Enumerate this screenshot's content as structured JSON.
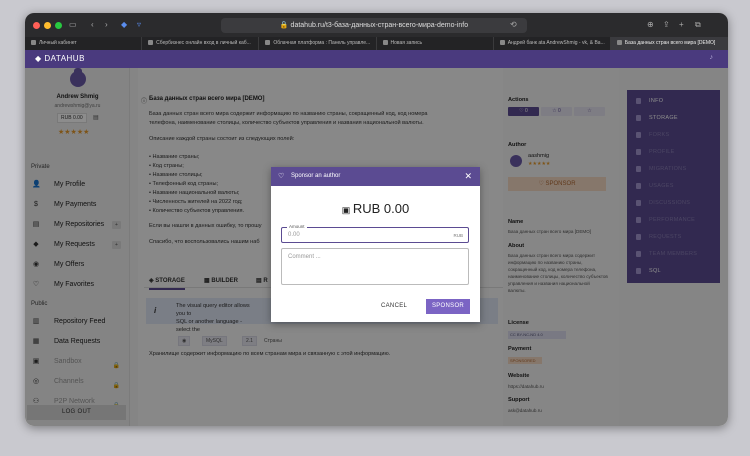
{
  "browser": {
    "url": "datahub.ru/t3-база-данных-стран-всего-мира-demo-info",
    "tabs": [
      {
        "label": "Личный кабинет"
      },
      {
        "label": "Сбербизнес онлайн вход в личный каб..."
      },
      {
        "label": "Облачная платформа : Панель управле..."
      },
      {
        "label": "Новая запись"
      },
      {
        "label": "Андрей банк ata AndrewShmig - vk, & Ва..."
      },
      {
        "label": "База данных стран всего мира [DEMO]"
      }
    ]
  },
  "app": {
    "brand": "DATAHUB"
  },
  "user": {
    "name": "Andrew Shmig",
    "email": "andrewshmig@ya.ru",
    "balance": "RUB 0.00",
    "stars": "★★★★★"
  },
  "sidebar": {
    "private_title": "Private",
    "public_title": "Public",
    "private_items": [
      {
        "label": "My Profile",
        "icon": "👤"
      },
      {
        "label": "My Payments",
        "icon": "$"
      },
      {
        "label": "My Repositories",
        "icon": "▤",
        "badge": "+"
      },
      {
        "label": "My Requests",
        "icon": "◆",
        "badge": "+"
      },
      {
        "label": "My Offers",
        "icon": "◉"
      },
      {
        "label": "My Favorites",
        "icon": "♡"
      }
    ],
    "public_items": [
      {
        "label": "Repository Feed",
        "icon": "▥"
      },
      {
        "label": "Data Requests",
        "icon": "▦"
      },
      {
        "label": "Sandbox",
        "icon": "▣",
        "lock": "🔒"
      },
      {
        "label": "Channels",
        "icon": "◎",
        "lock": "🔒"
      },
      {
        "label": "P2P Network",
        "icon": "⚇",
        "lock": "🔒"
      }
    ],
    "logout": "LOG OUT"
  },
  "main": {
    "title": "База данных стран всего мира [DEMO]",
    "desc1": "База данных стран всего мира содержит информацию по названию страны, сокращенный код, код номера",
    "desc2": "телефона, наименование столицы, количество субъектов управления и названия национальной валюты.",
    "desc3": "Описание каждой страны состоит из следующих полей:",
    "fields": [
      "Название страны;",
      "Код страны;",
      "Название столицы;",
      "Телефонный код страны;",
      "Название национальной валюты;",
      "Численность жителей на 2022 год;",
      "Количество субъектов управления."
    ],
    "error_text": "Если вы нашли в данных ошибку, то прошу",
    "thanks_text": "Спасибо, что воспользовались нашим наб",
    "tabs": [
      "STORAGE",
      "BUILDER",
      "R"
    ],
    "info1": "The visual query editor allows you to",
    "info2": "SQL or another language - select the",
    "chips": [
      "◉",
      "MySQL",
      "2.1",
      "Страны"
    ],
    "storage_desc": "Хранилище содержит информацию по всем странам мира и связанную с этой информацию."
  },
  "right": {
    "actions_label": "Actions",
    "actions": [
      "♡ 0",
      "☆ 0",
      "☆"
    ],
    "author_label": "Author",
    "author_name": "aashmig",
    "author_stars": "★★★★★",
    "sponsor": "♡ SPONSOR",
    "name_label": "Name",
    "name_value": "База данных стран всего мира [DEMO]",
    "about_label": "About",
    "about_value": "База данных стран всего мира содержит информацию по названию страны, сокращенный код, код номера телефона, наименование столицы, количество субъектов управления и названия национальной валюты.",
    "license_label": "License",
    "license_value": "CC BY-NC-ND 4.0",
    "payment_label": "Payment",
    "payment_value": "SPONSORED",
    "website_label": "Website",
    "website_value": "https://datahub.ru",
    "support_label": "Support",
    "support_value": "ask@datahub.ru"
  },
  "rightnav": [
    {
      "label": "INFO",
      "state": "active"
    },
    {
      "label": "STORAGE",
      "state": "active"
    },
    {
      "label": "FORKS",
      "state": "dim"
    },
    {
      "label": "PROFILE",
      "state": "dim"
    },
    {
      "label": "MIGRATIONS",
      "state": "dim"
    },
    {
      "label": "USAGES",
      "state": "dim"
    },
    {
      "label": "DISCUSSIONS",
      "state": "dim"
    },
    {
      "label": "PERFORMANCE",
      "state": "dim"
    },
    {
      "label": "REQUESTS",
      "state": "dim"
    },
    {
      "label": "TEAM MEMBERS",
      "state": "dim"
    },
    {
      "label": "SQL",
      "state": "active"
    }
  ],
  "modal": {
    "title": "Sponsor an author",
    "amount_display": "RUB 0.00",
    "amount_label": "Amount",
    "amount_placeholder": "0.00",
    "currency": "RUB",
    "comment_placeholder": "Comment ...",
    "cancel": "CANCEL",
    "sponsor": "SPONSOR"
  },
  "colors": {
    "accent": "#5b4b92",
    "button": "#7b64c4",
    "star": "#e59a2c"
  }
}
